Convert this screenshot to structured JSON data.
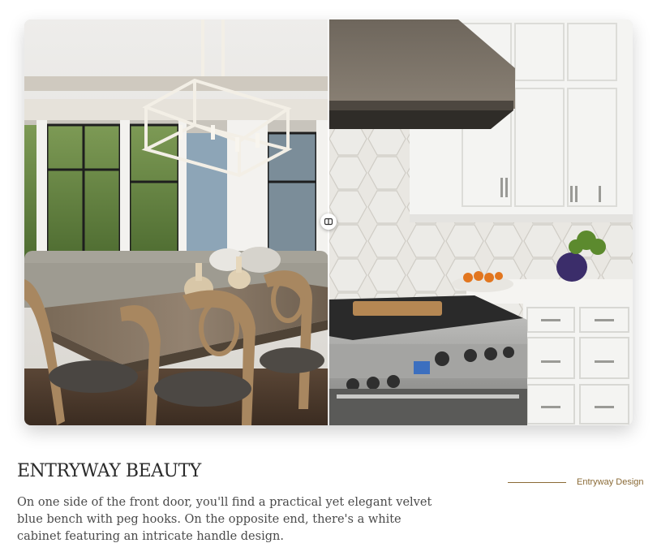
{
  "images": {
    "left_alt": "Dining nook with chandelier and round-back chairs",
    "right_alt": "White kitchen with range hood and gas range"
  },
  "article": {
    "title": "ENTRYWAY BEAUTY",
    "description": "On one side of the front door, you'll find a practical yet elegant velvet blue bench with peg hooks. On the opposite end, there's a white cabinet featuring an intricate handle design.",
    "category": "Entryway Design"
  },
  "comparison": {
    "handle_icon": "compare-slider-icon"
  },
  "colors": {
    "accent": "#8a6a36",
    "title": "#2a2a2a",
    "body_text": "#4a4a4a"
  }
}
